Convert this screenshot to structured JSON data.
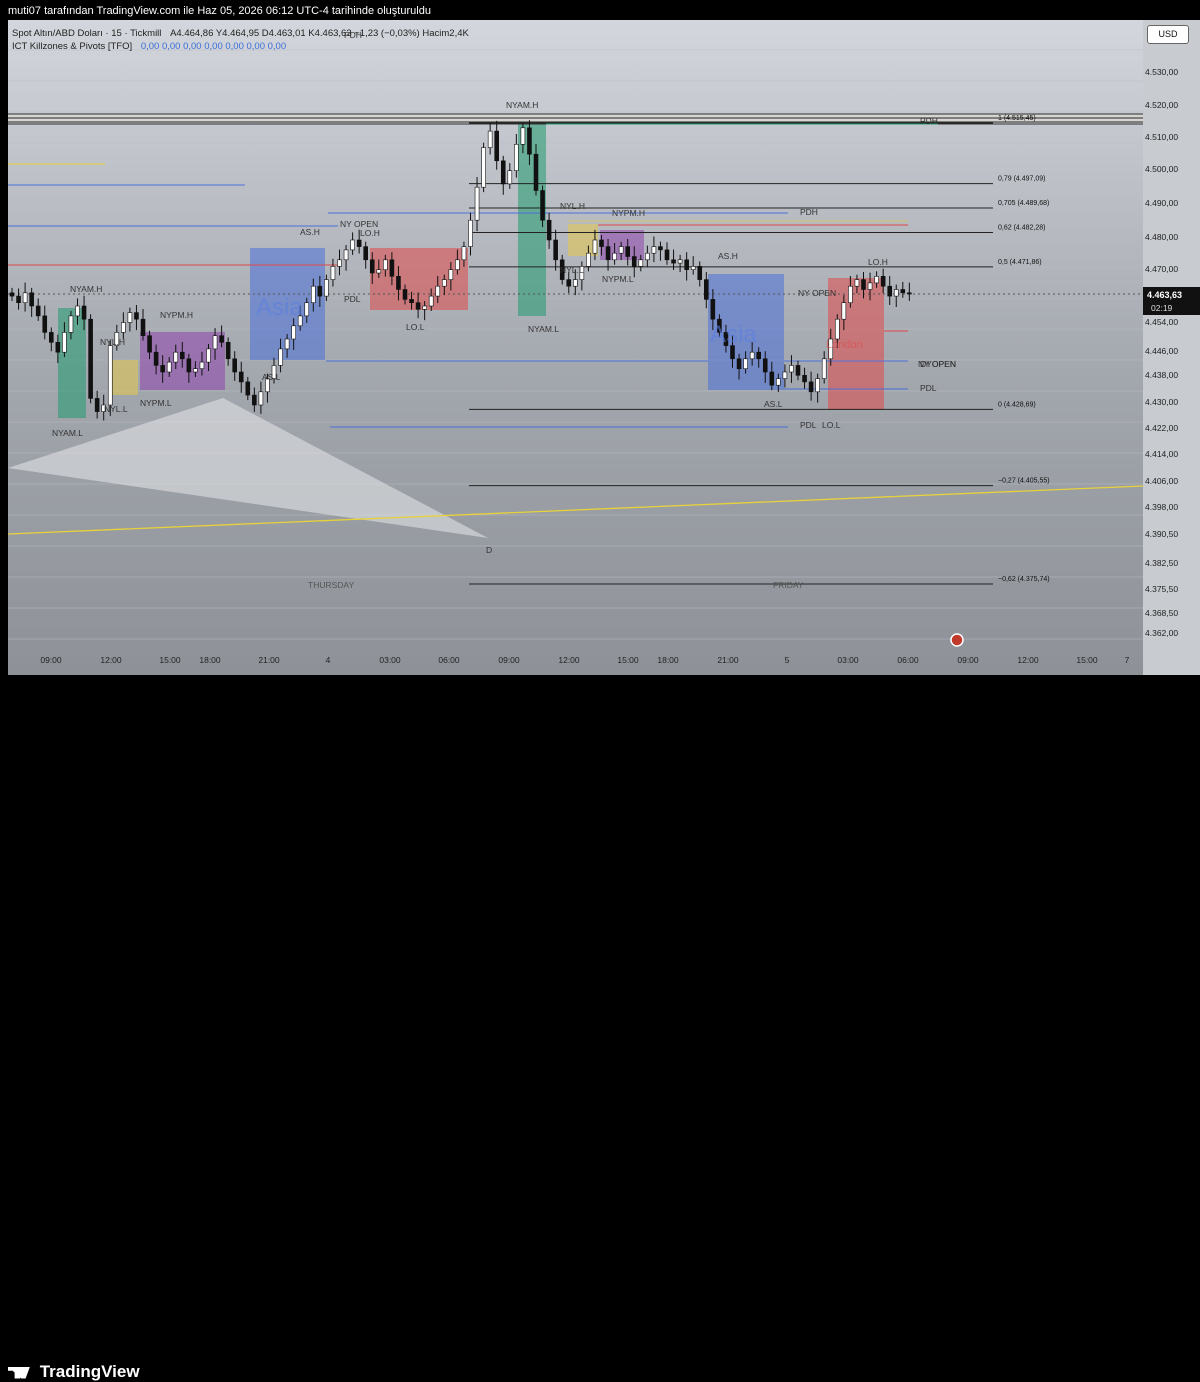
{
  "header": {
    "title": "muti07 tarafından TradingView.com ile Haz 05, 2026 06:12 UTC-4 tarihinde oluşturuldu"
  },
  "legend": {
    "symbol": "Spot Altın/ABD Doları · 15 · Tickmill",
    "ohlc": "A4.464,86  Y4.464,95  D4.463,01  K4.463,63  −1,23 (−0,03%)  Hacim2,4K",
    "indicator": "ICT Killzones & Pivots [TFO]",
    "indicator_values": "0,00  0,00  0,00  0,00  0,00  0,00  0,00"
  },
  "currency": "USD",
  "footer": {
    "logo": "TradingView"
  },
  "colors": {
    "up": "#ffffff",
    "down": "#111111",
    "asia": "#4a6fd8",
    "london": "#e04848",
    "nyam": "#1f9a6e",
    "nypm": "#8e44ad",
    "nyl": "#e6c84a"
  },
  "chart_data": {
    "type": "candlestick",
    "symbol": "XAUUSD",
    "interval": "15",
    "last_price": "4.463,63",
    "countdown": "02:19",
    "y_ticks": [
      "4.530,00",
      "4.520,00",
      "4.510,00",
      "4.500,00",
      "4.490,00",
      "4.480,00",
      "4.470,00",
      "4.454,00",
      "4.446,00",
      "4.438,00",
      "4.430,00",
      "4.422,00",
      "4.414,00",
      "4.406,00",
      "4.398,00",
      "4.390,50",
      "4.382,50",
      "4.375,50",
      "4.368,50",
      "4.362,00"
    ],
    "x_ticks": [
      "09:00",
      "12:00",
      "15:00",
      "18:00",
      "21:00",
      "4",
      "03:00",
      "06:00",
      "09:00",
      "12:00",
      "15:00",
      "18:00",
      "21:00",
      "5",
      "03:00",
      "06:00",
      "09:00",
      "12:00",
      "15:00",
      "7"
    ],
    "fib_levels": [
      {
        "label": "1 (4.515,45)",
        "price": 4515.45
      },
      {
        "label": "0,79 (4.497,09)",
        "price": 4497.09
      },
      {
        "label": "0,705 (4.489,68)",
        "price": 4489.68
      },
      {
        "label": "0,62 (4.482,28)",
        "price": 4482.28
      },
      {
        "label": "0,5 (4.471,86)",
        "price": 4471.86
      },
      {
        "label": "0 (4.428,69)",
        "price": 4428.69
      },
      {
        "label": "−0,27 (4.405,55)",
        "price": 4405.55
      },
      {
        "label": "−0,62 (4.375,74)",
        "price": 4375.74
      }
    ],
    "session_labels": [
      "NYAM.H",
      "NYAM.L",
      "NYL.H",
      "NYL.L",
      "NYPM.H",
      "NYPM.L",
      "AS.H",
      "AS.L",
      "LO.H",
      "LO.L",
      "NY OPEN",
      "PDH",
      "PDL",
      "D",
      "Asia",
      "London"
    ],
    "day_labels": [
      "THURSDAY",
      "FRIDAY"
    ],
    "annotations": [
      "DYOPEN"
    ],
    "candles_close": [
      4463,
      4461,
      4464,
      4460,
      4457,
      4452,
      4449,
      4446,
      4452,
      4457,
      4460,
      4456,
      4432,
      4428,
      4430,
      4448,
      4452,
      4455,
      4458,
      4456,
      4451,
      4446,
      4442,
      4440,
      4443,
      4446,
      4444,
      4440,
      4441,
      4443,
      4447,
      4451,
      4449,
      4444,
      4440,
      4437,
      4433,
      4430,
      4434,
      4438,
      4442,
      4447,
      4450,
      4454,
      4457,
      4461,
      4466,
      4463,
      4468,
      4472,
      4474,
      4477,
      4480,
      4478,
      4474,
      4470,
      4471,
      4474,
      4469,
      4465,
      4462,
      4461,
      4459,
      4460,
      4463,
      4466,
      4468,
      4471,
      4474,
      4478,
      4486,
      4496,
      4508,
      4513,
      4504,
      4497,
      4501,
      4509,
      4514,
      4506,
      4495,
      4486,
      4480,
      4474,
      4468,
      4466,
      4468,
      4472,
      4476,
      4480,
      4478,
      4474,
      4476,
      4478,
      4475,
      4472,
      4474,
      4476,
      4478,
      4477,
      4474,
      4473,
      4474,
      4471,
      4472,
      4468,
      4462,
      4456,
      4452,
      4448,
      4444,
      4441,
      4444,
      4446,
      4444,
      4440,
      4436,
      4438,
      4440,
      4442,
      4439,
      4437,
      4434,
      4438,
      4444,
      4450,
      4456,
      4461,
      4466,
      4468,
      4465,
      4467,
      4469,
      4466,
      4463,
      4465,
      4464,
      4463.63
    ]
  }
}
